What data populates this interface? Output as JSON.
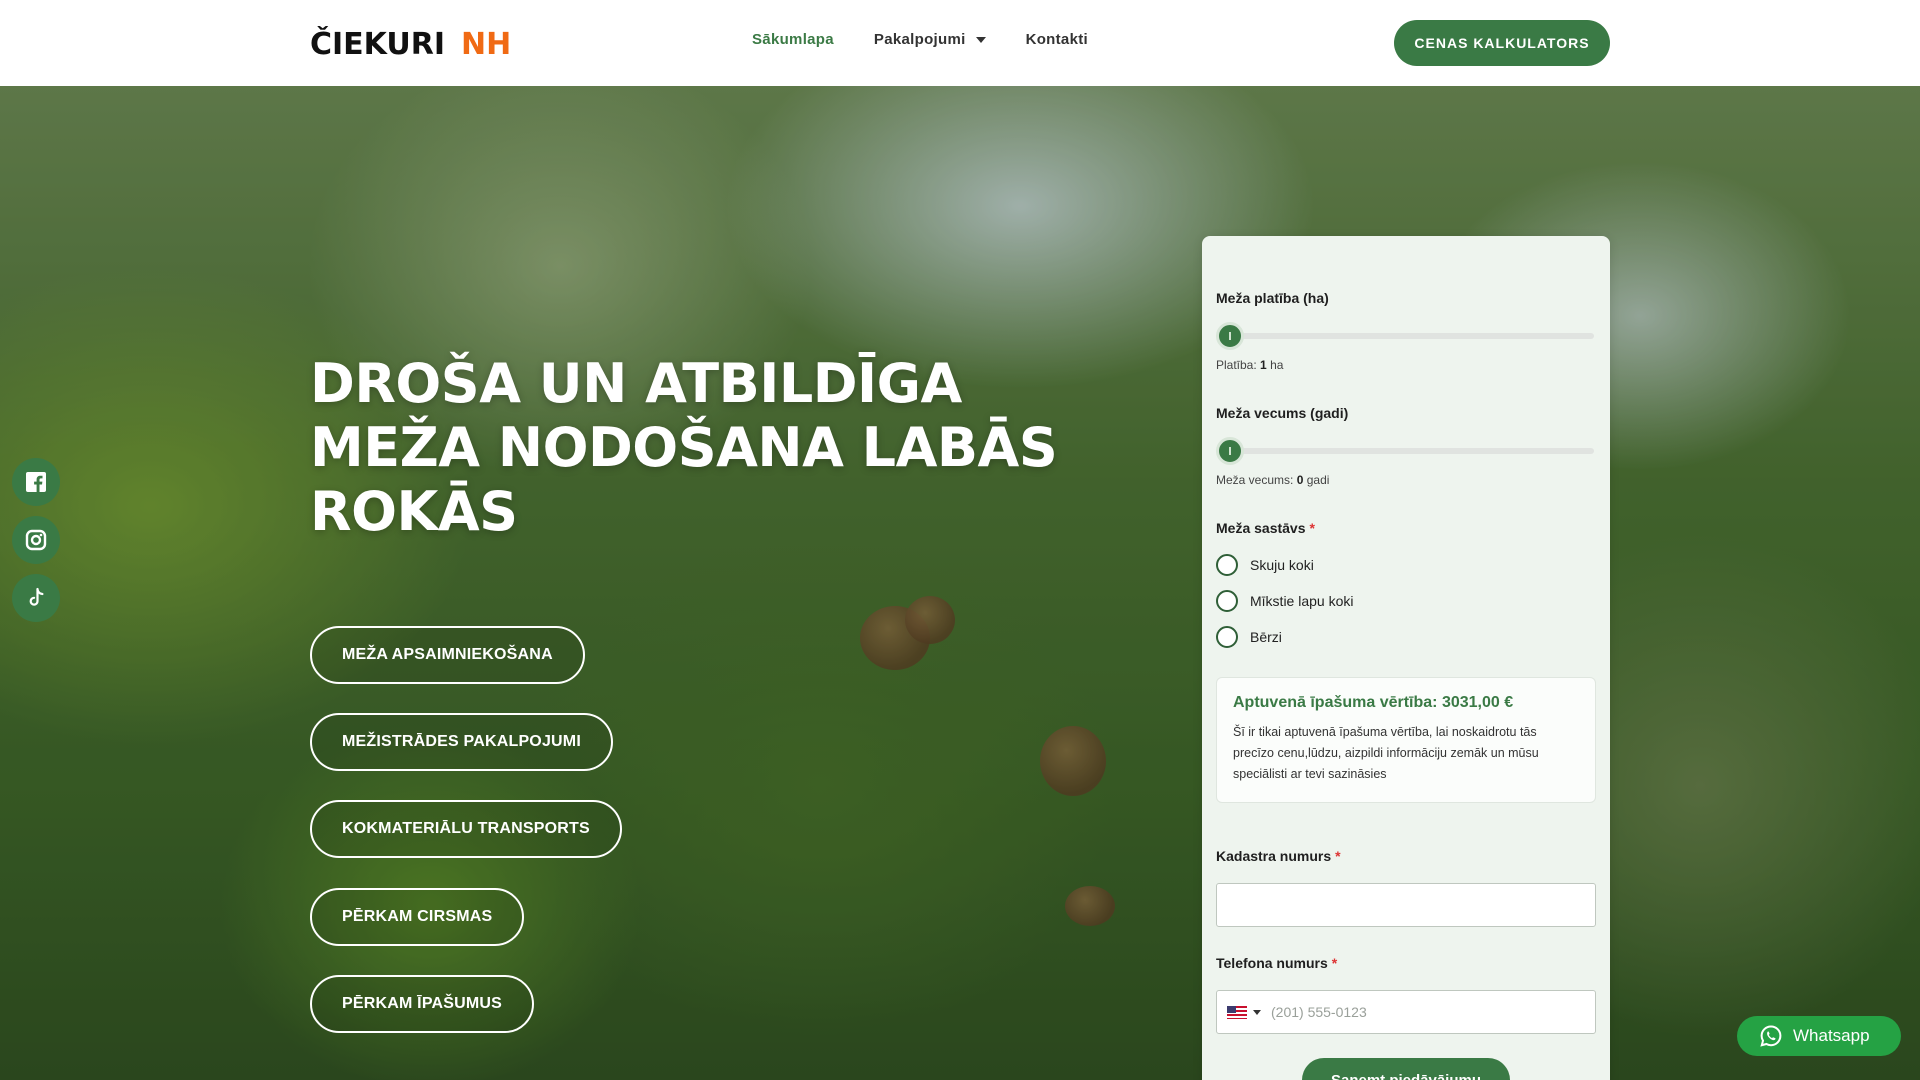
{
  "header": {
    "logo_main": "ČIEKURI",
    "logo_accent": "NH",
    "nav": [
      {
        "label": "Sākumlapa"
      },
      {
        "label": "Pakalpojumi"
      },
      {
        "label": "Kontakti"
      }
    ],
    "cta_label": "CENAS KALKULATORS"
  },
  "hero": {
    "headline": "DROŠA UN ATBILDĪGA MEŽA NODOŠANA LABĀS ROKĀS",
    "services": [
      {
        "label": "MEŽA APSAIMNIEKOŠANA"
      },
      {
        "label": "MEŽISTRĀDES PAKALPOJUMI"
      },
      {
        "label": "KOKMATERIĀLU TRANSPORTS"
      },
      {
        "label": "PĒRKAM CIRSMAS"
      },
      {
        "label": "PĒRKAM ĪPAŠUMUS"
      }
    ]
  },
  "social": [
    {
      "icon": "facebook-icon"
    },
    {
      "icon": "instagram-icon"
    },
    {
      "icon": "tiktok-icon"
    }
  ],
  "form": {
    "area": {
      "label": "Meža platība (ha)",
      "value_prefix": "Platība:",
      "value": "1",
      "unit": "ha",
      "slider_fraction": 0
    },
    "age": {
      "label": "Meža vecums (gadi)",
      "value_prefix": "Meža vecums:",
      "value": "0",
      "unit": "gadi",
      "slider_fraction": 0
    },
    "composition": {
      "label": "Meža sastāvs",
      "required_mark": "*",
      "options": [
        "Skuju koki",
        "Mīkstie lapu koki",
        "Bērzi"
      ]
    },
    "estimate": {
      "title": "Aptuvenā īpašuma vērtība: 3031,00 €",
      "description": "Šī ir tikai aptuvenā īpašuma vērtība, lai noskaidrotu tās precīzo cenu,lūdzu, aizpildi informāciju zemāk un mūsu speciālisti ar tevi sazināsies"
    },
    "cadastre": {
      "label": "Kadastra numurs",
      "required_mark": "*",
      "value": ""
    },
    "phone": {
      "label": "Telefona numurs",
      "required_mark": "*",
      "placeholder": "(201) 555-0123"
    },
    "submit_label": "Saņemt piedāvājumu"
  },
  "whatsapp_label": "Whatsapp",
  "colors": {
    "brand_green": "#3a7a45",
    "accent_orange": "#f06a14",
    "whatsapp_green": "#25a244"
  }
}
